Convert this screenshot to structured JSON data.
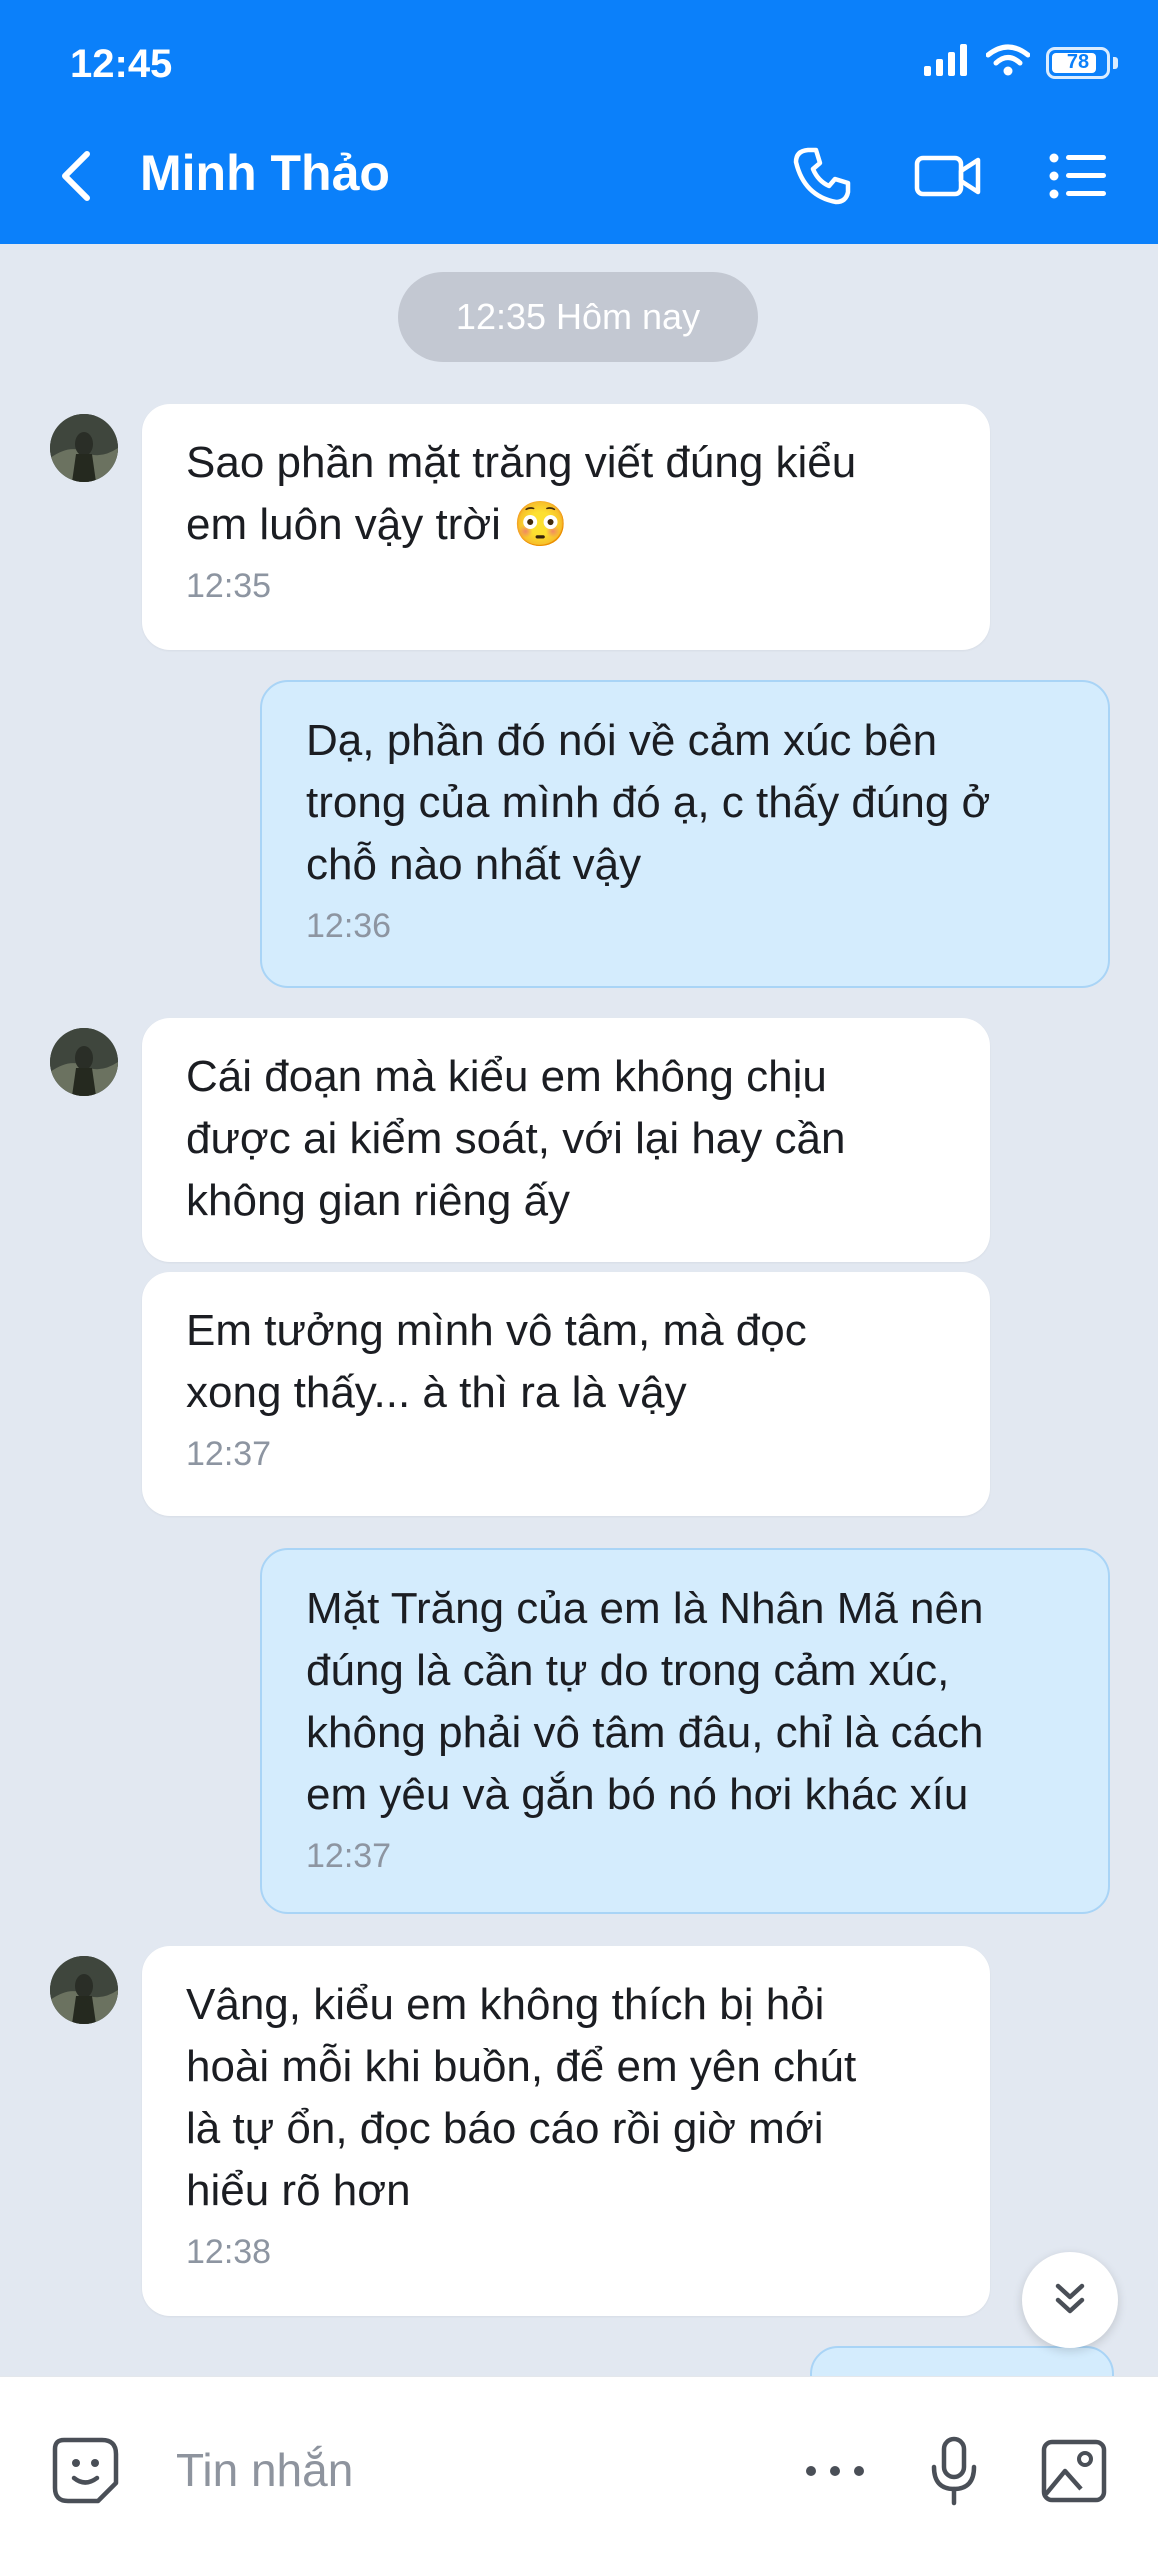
{
  "status_bar": {
    "time": "12:45",
    "battery_level": "78"
  },
  "header": {
    "title": "Minh Thảo"
  },
  "date_divider": "12:35 Hôm nay",
  "messages": [
    {
      "direction": "incoming",
      "lines": [
        "Sao phần mặt trăng viết đúng kiểu",
        "em luôn vậy trời 😳"
      ],
      "time": "12:35"
    },
    {
      "direction": "outgoing",
      "lines": [
        "Dạ, phần đó nói về cảm xúc bên",
        "trong của mình đó ạ, c thấy đúng ở",
        "chỗ nào nhất vậy"
      ],
      "time": "12:36"
    },
    {
      "direction": "incoming",
      "lines": [
        "Cái đoạn mà kiểu em không chịu",
        "được ai kiểm soát, với lại hay cần",
        "không gian riêng ấy"
      ],
      "time": ""
    },
    {
      "direction": "incoming",
      "lines": [
        "Em tưởng mình vô tâm, mà đọc",
        "xong thấy... à thì ra là vậy"
      ],
      "time": "12:37"
    },
    {
      "direction": "outgoing",
      "lines": [
        "Mặt Trăng của em là Nhân Mã nên",
        "đúng là cần tự do trong cảm xúc,",
        "không phải vô tâm đâu, chỉ là cách",
        "em yêu và gắn bó nó hơi khác xíu"
      ],
      "time": "12:37"
    },
    {
      "direction": "incoming",
      "lines": [
        "Vâng, kiểu em không thích bị hỏi",
        "hoài mỗi khi buồn, để em yên chút",
        "là tự ổn, đọc báo cáo rồi giờ mới",
        "hiểu rõ hơn"
      ],
      "time": "12:38"
    }
  ],
  "composer": {
    "placeholder": "Tin nhắn"
  },
  "colors": {
    "header_bg": "#0b80fa",
    "chat_bg": "#e2e8f1",
    "incoming_bubble": "#ffffff",
    "outgoing_bubble": "#d4ecfd",
    "timestamp": "#8d95a1"
  }
}
